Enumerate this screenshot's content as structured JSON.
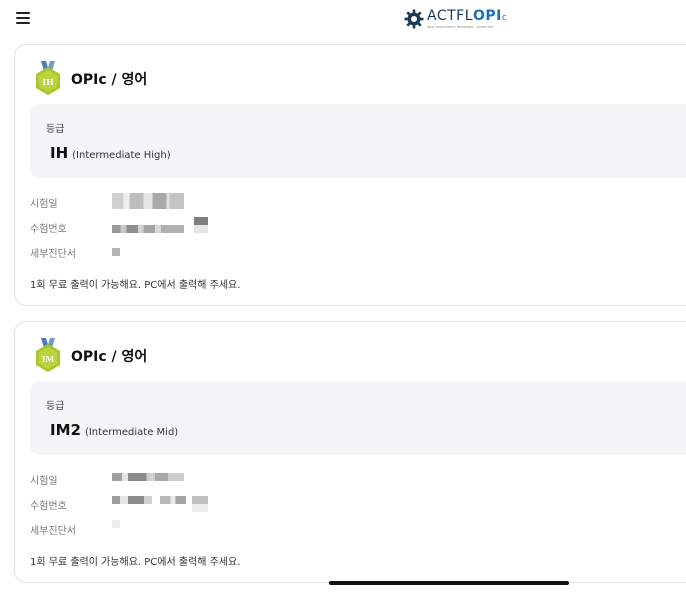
{
  "header": {
    "menu_icon": "hamburger-menu-icon",
    "logo": {
      "prefix": "ACTFL",
      "bold": "OPI",
      "suffix": "c",
      "tagline": "ORAL PROFICIENCY INTERVIEW - COMPUTER"
    }
  },
  "cards": [
    {
      "medal_icon": "medal-badge-icon",
      "medal_text": "IH",
      "title": "OPIc / 영어",
      "grade_label": "등급",
      "grade_code": "IH",
      "grade_desc": "(Intermediate High)",
      "fields": [
        {
          "label": "시험일"
        },
        {
          "label": "수험번호"
        },
        {
          "label": "세부진단서"
        }
      ],
      "note": "1회 무료 출력이 가능해요. PC에서 출력해 주세요."
    },
    {
      "medal_icon": "medal-badge-icon",
      "medal_text": "IM",
      "title": "OPIc / 영어",
      "grade_label": "등급",
      "grade_code": "IM2",
      "grade_desc": "(Intermediate Mid)",
      "fields": [
        {
          "label": "시험일"
        },
        {
          "label": "수험번호"
        },
        {
          "label": "세부진단서"
        }
      ],
      "note": "1회 무료 출력이 가능해요. PC에서 출력해 주세요."
    }
  ],
  "colors": {
    "medal": "#a6c42c",
    "ribbon": "#4a7fb5",
    "logo_blue": "#1b6fb8",
    "grade_bg": "#f4f5f7"
  }
}
